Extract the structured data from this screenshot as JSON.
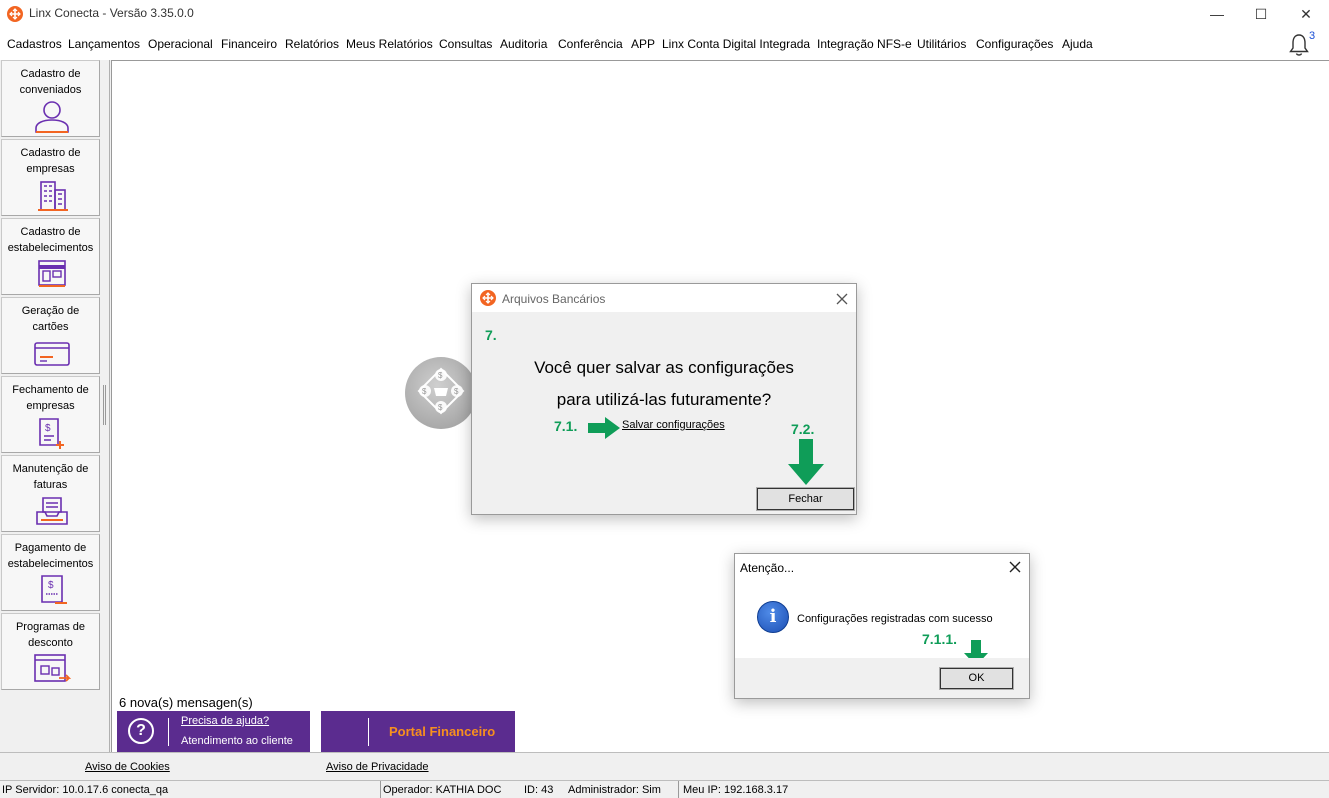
{
  "window": {
    "title": "Linx Conecta - Versão 3.35.0.0",
    "minimize": "—",
    "maximize": "☐",
    "close": "✕"
  },
  "menu": [
    "Cadastros",
    "Lançamentos",
    "Operacional",
    "Financeiro",
    "Relatórios",
    "Meus Relatórios",
    "Consultas",
    "Auditoria",
    "Conferência",
    "APP",
    "Linx Conta Digital Integrada",
    "Integração NFS-e",
    "Utilitários",
    "Configurações",
    "Ajuda"
  ],
  "notifications": {
    "count": "3"
  },
  "sidebar": [
    {
      "label": "Cadastro de conveniados",
      "icon": "person-icon"
    },
    {
      "label": "Cadastro de empresas",
      "icon": "building-icon"
    },
    {
      "label": "Cadastro de estabelecimentos",
      "icon": "store-icon"
    },
    {
      "label": "Geração de cartões",
      "icon": "card-icon"
    },
    {
      "label": "Fechamento de empresas",
      "icon": "invoice-plus-icon"
    },
    {
      "label": "Manutenção de faturas",
      "icon": "tray-icon"
    },
    {
      "label": "Pagamento de estabelecimentos",
      "icon": "receipt-icon"
    },
    {
      "label": "Programas de desconto",
      "icon": "discount-program-icon"
    }
  ],
  "workspace": {
    "messages": "6 nova(s) mensagen(s)",
    "help": {
      "line1": "Precisa de ajuda?",
      "line2": "Atendimento ao cliente",
      "icon": "?"
    },
    "portal": {
      "label": "Portal Financeiro"
    }
  },
  "dialog_arquivos": {
    "title": "Arquivos Bancários",
    "step": "7.",
    "question_line1": "Você quer salvar as configurações",
    "question_line2": "para utilizá-las futuramente?",
    "step_save": "7.1.",
    "save_link": "Salvar configurações",
    "step_close": "7.2.",
    "close_button": "Fechar"
  },
  "dialog_atencao": {
    "title": "Atenção...",
    "message": "Configurações registradas com sucesso",
    "step_ok": "7.1.1.",
    "ok_button": "OK",
    "info_glyph": "i"
  },
  "footer": {
    "cookies": "Aviso de Cookies",
    "privacy": "Aviso de Privacidade"
  },
  "status": {
    "server": "IP Servidor: 10.0.17.6 conecta_qa",
    "operator": "Operador: KATHIA DOC",
    "id": "ID: 43",
    "admin": "Administrador: Sim",
    "myip": "Meu IP: 192.168.3.17"
  },
  "colors": {
    "brand_orange": "#f26522",
    "brand_purple": "#5b2c8f",
    "annotation_green": "#0f9d58",
    "portal_text": "#f7901e",
    "sidebar_icon_purple": "#6a2fb0"
  }
}
